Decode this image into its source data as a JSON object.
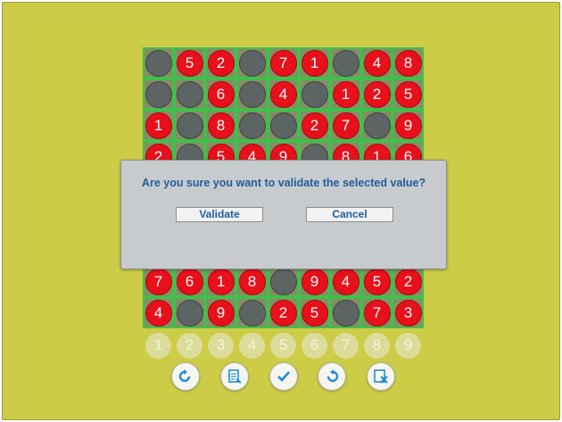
{
  "board": {
    "rows": [
      [
        "",
        "5",
        "2",
        "",
        "7",
        "1",
        "",
        "4",
        "8"
      ],
      [
        "",
        "",
        "6",
        "",
        "4",
        "",
        "1",
        "2",
        "5"
      ],
      [
        "1",
        "",
        "8",
        "",
        "",
        "2",
        "7",
        "",
        "9"
      ],
      [
        "2",
        "",
        "5",
        "4",
        "9",
        "",
        "8",
        "1",
        "6"
      ],
      [
        "",
        "",
        "",
        "",
        "",
        "",
        "",
        "",
        ""
      ],
      [
        "",
        "",
        "",
        "",
        "",
        "",
        "",
        "",
        ""
      ],
      [
        "",
        "",
        "",
        "",
        "",
        "",
        "",
        "",
        ""
      ],
      [
        "7",
        "6",
        "1",
        "8",
        "",
        "9",
        "4",
        "5",
        "2"
      ],
      [
        "4",
        "",
        "9",
        "",
        "2",
        "5",
        "",
        "7",
        "3"
      ]
    ]
  },
  "number_buttons": [
    "1",
    "2",
    "3",
    "4",
    "5",
    "6",
    "7",
    "8",
    "9"
  ],
  "toolbar": {
    "items": [
      {
        "name": "redo-icon"
      },
      {
        "name": "notes-icon"
      },
      {
        "name": "checkmark-icon"
      },
      {
        "name": "undo-icon"
      },
      {
        "name": "clear-icon"
      }
    ]
  },
  "dialog": {
    "message": "Are you sure you want to validate the selected value?",
    "validate_label": "Validate",
    "cancel_label": "Cancel"
  },
  "colors": {
    "background": "#cccc46",
    "grid_line": "#3cc24a",
    "disc_red": "#e8101a",
    "disc_gray": "#5d6464",
    "dialog_text": "#1e5d9c"
  }
}
